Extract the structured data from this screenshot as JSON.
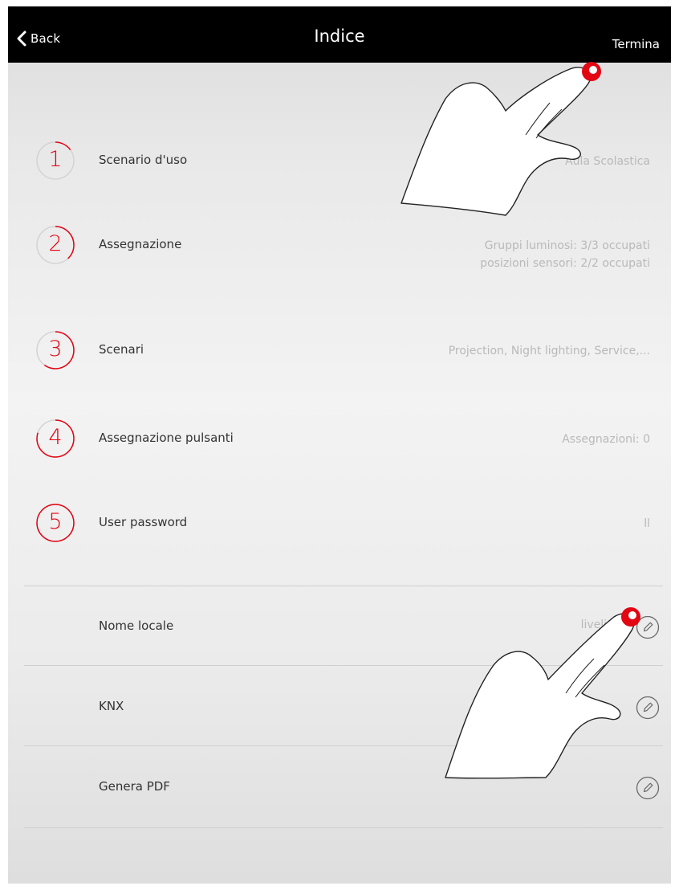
{
  "navbar": {
    "back_label": "Back",
    "title": "Indice",
    "action_label": "Termina"
  },
  "steps": [
    {
      "number": "1",
      "label": "Scenario d'uso",
      "value": "Aula Scolastica",
      "progress": 0.15
    },
    {
      "number": "2",
      "label": "Assegnazione",
      "value_line1": "Gruppi luminosi: 3/3 occupati",
      "value_line2": "posizioni sensori: 2/2 occupati",
      "progress": 0.38
    },
    {
      "number": "3",
      "label": "Scenari",
      "value": "Projection, Night lighting, Service,...",
      "progress": 0.6
    },
    {
      "number": "4",
      "label": "Assegnazione pulsanti",
      "value": "Assegnazioni: 0",
      "progress": 0.8
    },
    {
      "number": "5",
      "label": "User password",
      "value": "ll",
      "progress": 1.0
    }
  ],
  "settings": [
    {
      "label": "Nome locale",
      "value": "livelink"
    },
    {
      "label": "KNX",
      "value": ""
    },
    {
      "label": "Genera PDF",
      "value": ""
    }
  ],
  "icons": {
    "back": "chevron-left-icon",
    "edit": "pencil-icon",
    "tap_hint": "pointing-hand-icon"
  },
  "colors": {
    "accent": "#e30613",
    "navbar": "#000000",
    "muted_text": "#b9b9b9"
  }
}
